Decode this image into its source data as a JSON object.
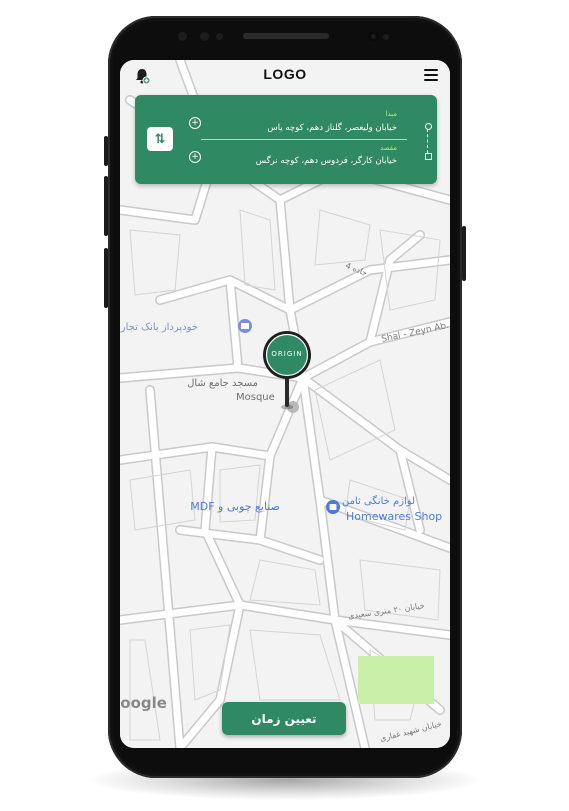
{
  "header": {
    "logo_text": "LOGO",
    "bell_icon": "bell-icon",
    "menu_icon": "hamburger-icon"
  },
  "route": {
    "origin_label": "مبدا",
    "origin_value": "خیابان ولیعصر، گلناز دهم، کوچه یاس",
    "destination_label": "مقصد",
    "destination_value": "خیابان کارگر، فردوس دهم، کوچه نرگس",
    "swap_icon": "swap-vertical-icon",
    "add_icon": "plus-circle-icon"
  },
  "map": {
    "pin_label": "ORIGIN",
    "labels": {
      "bank": "خودپرداز بانک تجارت",
      "mosque_fa": "مسجد جامع شال",
      "mosque_en": "Mosque",
      "shop_fa": "لوازم خانگی ثامن",
      "shop_en": "Homewares Shop",
      "wood_fa": "صنایع چوبی و MDF",
      "street_shal": "Shal - Zeyn Ab...",
      "street_20m": "خیابان ۲۰ متری سعیدی",
      "street_ghafari": "خیابان شهید غفاری",
      "street_jaddeh4": "جاده 4",
      "google": "Google"
    }
  },
  "actions": {
    "set_time_label": "تعیین زمان"
  },
  "colors": {
    "accent": "#2f8a64",
    "label_highlight": "#b4f06a",
    "map_bg": "#f4f4f4",
    "road": "#ffffff",
    "block_outline": "#c9c9c9",
    "park": "#c8f0a8"
  }
}
